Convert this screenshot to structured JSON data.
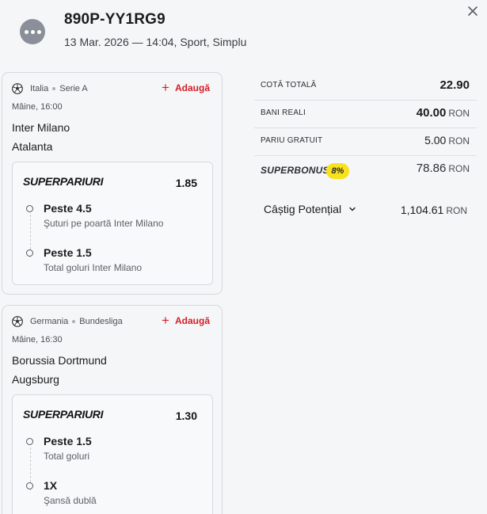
{
  "ticket": {
    "id": "890P-YY1RG9",
    "meta": "13 Mar. 2026 — 14:04, Sport, Simplu"
  },
  "events": [
    {
      "country": "Italia",
      "league": "Serie A",
      "add_label": "Adaugă",
      "kickoff": "Mâine, 16:00",
      "home": "Inter Milano",
      "away": "Atalanta",
      "market": "SUPERPARIURI",
      "odds": "1.85",
      "selections": [
        {
          "pick": "Peste 4.5",
          "desc": "Şuturi pe poartă Inter Milano"
        },
        {
          "pick": "Peste 1.5",
          "desc": "Total goluri Inter Milano"
        }
      ]
    },
    {
      "country": "Germania",
      "league": "Bundesliga",
      "add_label": "Adaugă",
      "kickoff": "Mâine, 16:30",
      "home": "Borussia Dortmund",
      "away": "Augsburg",
      "market": "SUPERPARIURI",
      "odds": "1.30",
      "selections": [
        {
          "pick": "Peste 1.5",
          "desc": "Total goluri"
        },
        {
          "pick": "1X",
          "desc": "Şansă dublă"
        }
      ]
    }
  ],
  "summary": {
    "total_odds_label": "COTĂ TOTALĂ",
    "total_odds": "22.90",
    "real_money_label": "BANI REALI",
    "real_money": "40.00",
    "free_bet_label": "PARIU GRATUIT",
    "free_bet": "5.00",
    "superbonus_label": "SUPERBONUS",
    "superbonus_pct": "8%",
    "superbonus": "78.86",
    "currency": "RON"
  },
  "potential": {
    "label": "Câștig Potențial",
    "value": "1,104.61",
    "currency": "RON"
  },
  "colors": {
    "accent": "#d4202a",
    "badge": "#f7e21b",
    "avatar": "#8a8f99"
  },
  "icons": [
    "more-icon",
    "close-icon",
    "soccer-ball-icon",
    "plus-icon",
    "chevron-down-icon"
  ]
}
